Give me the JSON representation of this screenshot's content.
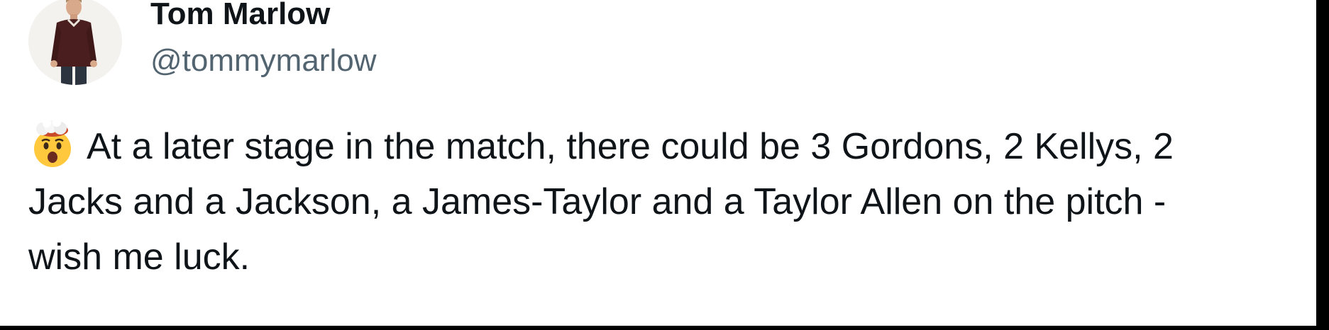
{
  "tweet": {
    "author": {
      "display_name": "Tom Marlow",
      "handle": "@tommymarlow",
      "avatar_icon": "profile-photo"
    },
    "emoji_icon": "exploding-head-emoji",
    "text_lines": [
      "At a later stage in the match, there could be 3 Gordons, 2 Kellys, 2",
      "Jacks and a Jackson, a James-Taylor and a Taylor Allen on the pitch -",
      "wish me luck."
    ]
  },
  "colors": {
    "name": "#0f1419",
    "handle": "#536471",
    "background": "#ffffff",
    "frame": "#000000"
  }
}
